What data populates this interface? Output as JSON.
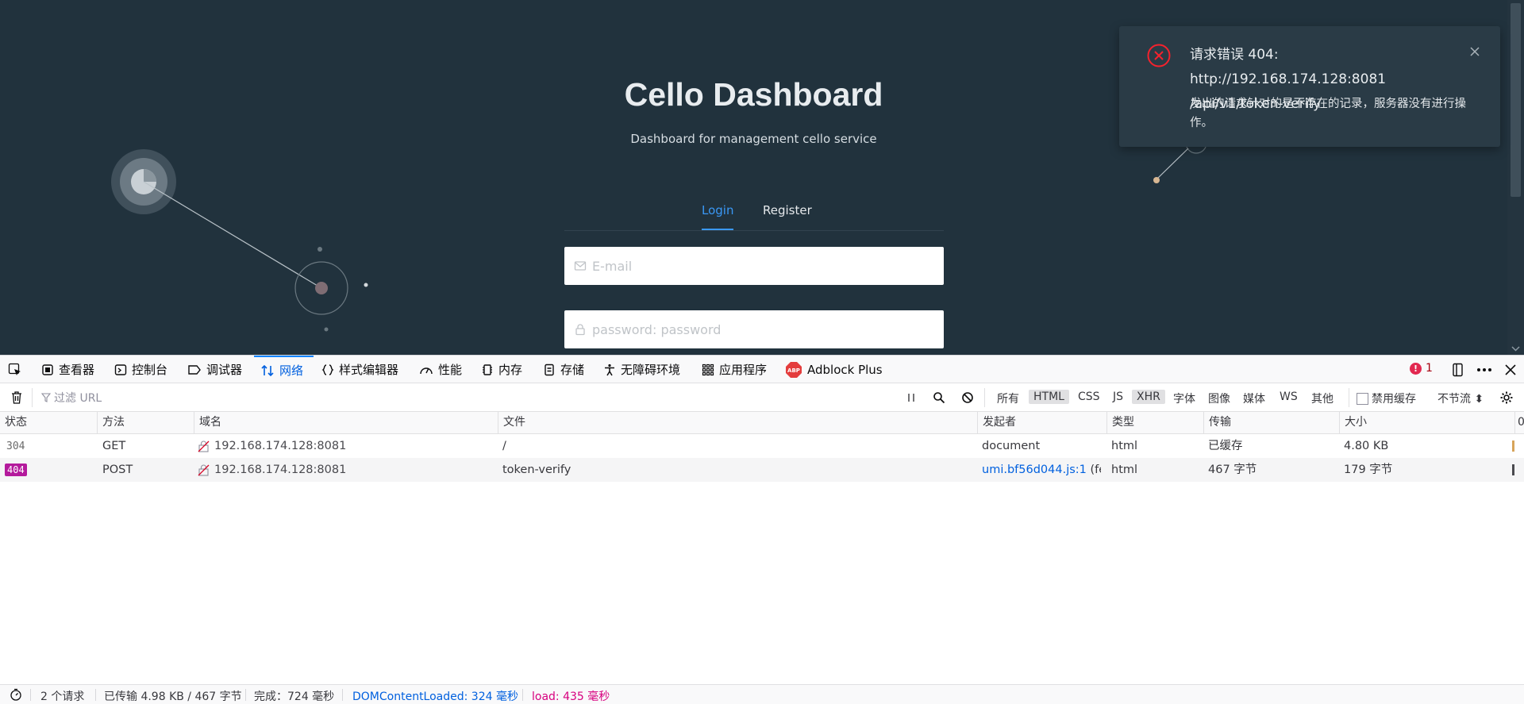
{
  "page": {
    "title": "Cello Dashboard",
    "subtitle": "Dashboard for management cello service",
    "tabs": [
      {
        "label": "Login",
        "active": true
      },
      {
        "label": "Register",
        "active": false
      }
    ],
    "email_placeholder": "E-mail",
    "password_placeholder": "password: password"
  },
  "notification": {
    "title": "请求错误 404: http://192.168.174.128:8081/api/v1/token-verify",
    "title_line1": "请求错误 404: http://192.168.174.128:8081",
    "title_line2": "/api/v1/token-verify",
    "description": "发出的请求针对的是不存在的记录，服务器没有进行操作。",
    "accent_color": "#f5222d"
  },
  "devtools": {
    "tabs": [
      {
        "label": "查看器",
        "icon": "inspector-icon"
      },
      {
        "label": "控制台",
        "icon": "console-icon"
      },
      {
        "label": "调试器",
        "icon": "debugger-icon"
      },
      {
        "label": "网络",
        "icon": "network-icon",
        "active": true
      },
      {
        "label": "样式编辑器",
        "icon": "style-editor-icon"
      },
      {
        "label": "性能",
        "icon": "performance-icon"
      },
      {
        "label": "内存",
        "icon": "memory-icon"
      },
      {
        "label": "存储",
        "icon": "storage-icon"
      },
      {
        "label": "无障碍环境",
        "icon": "accessibility-icon"
      },
      {
        "label": "应用程序",
        "icon": "application-icon"
      },
      {
        "label": "Adblock Plus",
        "icon": "adblock-icon"
      }
    ],
    "error_count": "1",
    "filter_placeholder": "过滤 URL",
    "type_filters": [
      {
        "label": "所有",
        "on": false
      },
      {
        "label": "HTML",
        "on": true
      },
      {
        "label": "CSS",
        "on": false
      },
      {
        "label": "JS",
        "on": false
      },
      {
        "label": "XHR",
        "on": true
      },
      {
        "label": "字体",
        "on": false
      },
      {
        "label": "图像",
        "on": false
      },
      {
        "label": "媒体",
        "on": false
      },
      {
        "label": "WS",
        "on": false
      },
      {
        "label": "其他",
        "on": false
      }
    ],
    "disable_cache_label": "禁用缓存",
    "throttle_label": "不节流 ⬍",
    "columns": [
      "状态",
      "方法",
      "域名",
      "文件",
      "发起者",
      "类型",
      "传输",
      "大小",
      "0"
    ],
    "requests": [
      {
        "status": "304",
        "method": "GET",
        "domain": "192.168.174.128:8081",
        "file": "/",
        "initiator": "document",
        "initiator_link": "",
        "initiator_extra": "",
        "type": "html",
        "transferred": "已缓存",
        "size": "4.80 KB"
      },
      {
        "status": "404",
        "method": "POST",
        "domain": "192.168.174.128:8081",
        "file": "token-verify",
        "initiator": "",
        "initiator_link": "umi.bf56d044.js:1",
        "initiator_extra": " (fe...",
        "type": "html",
        "transferred": "467 字节",
        "size": "179 字节"
      }
    ],
    "status_bar": {
      "requests": "2 个请求",
      "transferred": "已传输 4.98 KB / 467 字节",
      "finish": "完成：724 毫秒",
      "dom_content_loaded": "DOMContentLoaded: 324 毫秒",
      "load": "load: 435 毫秒"
    }
  }
}
